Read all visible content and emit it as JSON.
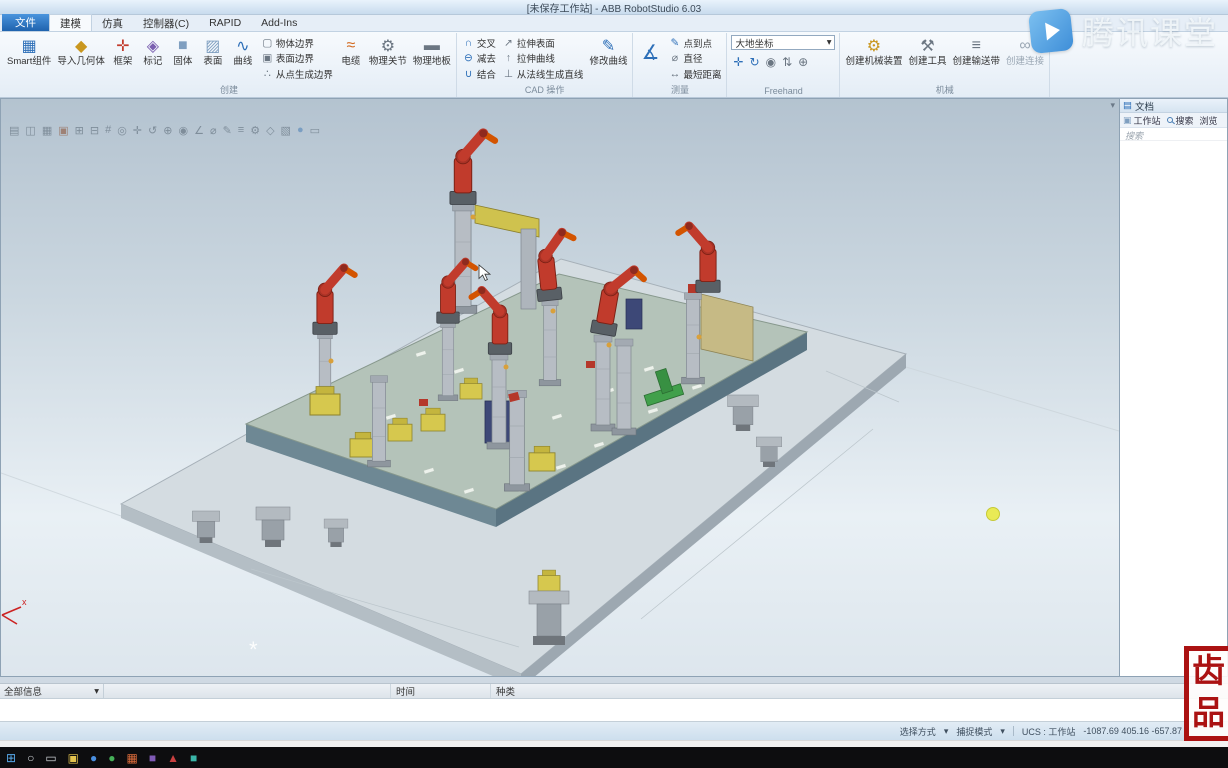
{
  "window": {
    "title": "[未保存工作站] - ABB RobotStudio 6.03"
  },
  "watermark": {
    "brand": "腾讯课堂"
  },
  "menu": {
    "file_tab": "文件",
    "tabs": [
      {
        "label": "建模"
      },
      {
        "label": "仿真"
      },
      {
        "label": "控制器(C)"
      },
      {
        "label": "RAPID"
      },
      {
        "label": "Add-Ins"
      }
    ]
  },
  "icons": {
    "caret": "▾",
    "smart": "▦",
    "import_geo": "◆",
    "frame": "✛",
    "tag": "◈",
    "solid": "■",
    "surface": "▨",
    "curve": "∿",
    "body_border": "▢",
    "surface_border": "▣",
    "points_border": "∴",
    "cable": "≈",
    "physics_joint": "⚙",
    "physics_floor": "▬",
    "intersect": "∩",
    "subtract": "⊖",
    "union": "∪",
    "extrude_surface": "↗",
    "extrude_curve": "↑",
    "line_from_normal": "⊥",
    "modify_curve": "✎",
    "measure_tool": "∡",
    "p2p": "✎",
    "diameter": "⌀",
    "min_dist": "↔",
    "create_mech": "⚙",
    "create_tool": "⚒",
    "create_conveyor": "≡",
    "create_connection": "∞",
    "doc": "▤"
  },
  "ribbon": {
    "create": {
      "name": "创建",
      "smart": "Smart组件",
      "import_geo": "导入几何体",
      "frame": "框架",
      "tag": "标记",
      "solid": "固体",
      "surface": "表面",
      "curve": "曲线",
      "body_border": "物体边界",
      "surface_border": "表面边界",
      "points_border": "从点生成边界",
      "cable": "电缆",
      "physics_joint": "物理关节",
      "physics_floor": "物理地板"
    },
    "cad": {
      "name": "CAD 操作",
      "intersect": "交叉",
      "subtract": "减去",
      "union": "结合",
      "extrude_surface": "拉伸表面",
      "extrude_curve": "拉伸曲线",
      "line_from_normal": "从法线生成直线",
      "modify_curve": "修改曲线"
    },
    "measure": {
      "name": "测量",
      "p2p": "点到点",
      "diameter": "直径",
      "min_dist": "最短距离"
    },
    "freehand": {
      "name": "Freehand",
      "reference": "大地坐标",
      "icons": [
        {
          "name": "jog-move-icon",
          "glyph": "✛",
          "color": "#2d6fb8"
        },
        {
          "name": "jog-rotate-icon",
          "glyph": "↻",
          "color": "#2d6fb8"
        },
        {
          "name": "jog-joint-icon",
          "glyph": "◉",
          "color": "#6b7682"
        },
        {
          "name": "jog-linear-icon",
          "glyph": "⇅",
          "color": "#6b7682"
        },
        {
          "name": "multirobot-jog-icon",
          "glyph": "⊕",
          "color": "#6b7682"
        }
      ]
    },
    "mechanism": {
      "name": "机械",
      "create_mech": "创建机械装置",
      "create_tool": "创建工具",
      "create_conveyor": "创建输送带",
      "create_connection": "创建连接"
    }
  },
  "viewport": {
    "collapse_glyph": "▾",
    "toolbar_icons": [
      {
        "name": "view-settings-icon",
        "glyph": "▤"
      },
      {
        "name": "split-view-icon",
        "glyph": "◫"
      },
      {
        "name": "grid-icon",
        "glyph": "▦"
      },
      {
        "name": "markup-icon",
        "glyph": "▣",
        "color": "#8a4a2a"
      },
      {
        "name": "zoom-extents-icon",
        "glyph": "⊞"
      },
      {
        "name": "zoom-out-icon",
        "glyph": "⊟"
      },
      {
        "name": "snap-grid-icon",
        "glyph": "#"
      },
      {
        "name": "center-view-icon",
        "glyph": "◎"
      },
      {
        "name": "pan-icon",
        "glyph": "✛"
      },
      {
        "name": "orbit-icon",
        "glyph": "↺"
      },
      {
        "name": "zoom-in-icon",
        "glyph": "⊕"
      },
      {
        "name": "target-icon",
        "glyph": "◉"
      },
      {
        "name": "angle-icon",
        "glyph": "∠"
      },
      {
        "name": "diameter-icon",
        "glyph": "⌀"
      },
      {
        "name": "annotate-icon",
        "glyph": "✎"
      },
      {
        "name": "layers-icon",
        "glyph": "≡"
      },
      {
        "name": "options-icon",
        "glyph": "⚙"
      },
      {
        "name": "wireframe-icon",
        "glyph": "◇"
      },
      {
        "name": "shading-icon",
        "glyph": "▧"
      },
      {
        "name": "render-icon",
        "glyph": "●",
        "color": "#4a7fb5"
      },
      {
        "name": "window-icon",
        "glyph": "▭"
      }
    ]
  },
  "right_panel": {
    "title": "文档",
    "tabs": [
      {
        "label": "工作站"
      },
      {
        "label": "搜索"
      },
      {
        "label": "浏览"
      }
    ],
    "search_placeholder": "搜索"
  },
  "output_panel": {
    "filter": "全部信息",
    "columns": {
      "time": "时间",
      "category": "种类"
    }
  },
  "status_bar": {
    "selection": "选择方式",
    "snap": "捕捉模式",
    "ucs": "UCS : 工作站",
    "coords": "-1087.69  405.16  -657.87"
  },
  "taskbar": {
    "icons": [
      {
        "name": "start-button",
        "glyph": "⊞",
        "color": "#57a8e8"
      },
      {
        "name": "search-icon",
        "glyph": "○",
        "color": "#d0d4d8"
      },
      {
        "name": "task-view-icon",
        "glyph": "▭",
        "color": "#c8ccd0"
      },
      {
        "name": "file-explorer-icon",
        "glyph": "▣",
        "color": "#e3c34e"
      },
      {
        "name": "browser-icon",
        "glyph": "●",
        "color": "#4a8fe0"
      },
      {
        "name": "app-green-icon",
        "glyph": "●",
        "color": "#45b058"
      },
      {
        "name": "app-orange-icon",
        "glyph": "▦",
        "color": "#d86a3a"
      },
      {
        "name": "app-purple-icon",
        "glyph": "■",
        "color": "#7f5ab5"
      },
      {
        "name": "app-red-icon",
        "glyph": "▲",
        "color": "#c94040"
      },
      {
        "name": "app-teal-icon",
        "glyph": "■",
        "color": "#3ab5a8"
      }
    ]
  },
  "seal": {
    "line1": "齿",
    "line2": "品"
  }
}
